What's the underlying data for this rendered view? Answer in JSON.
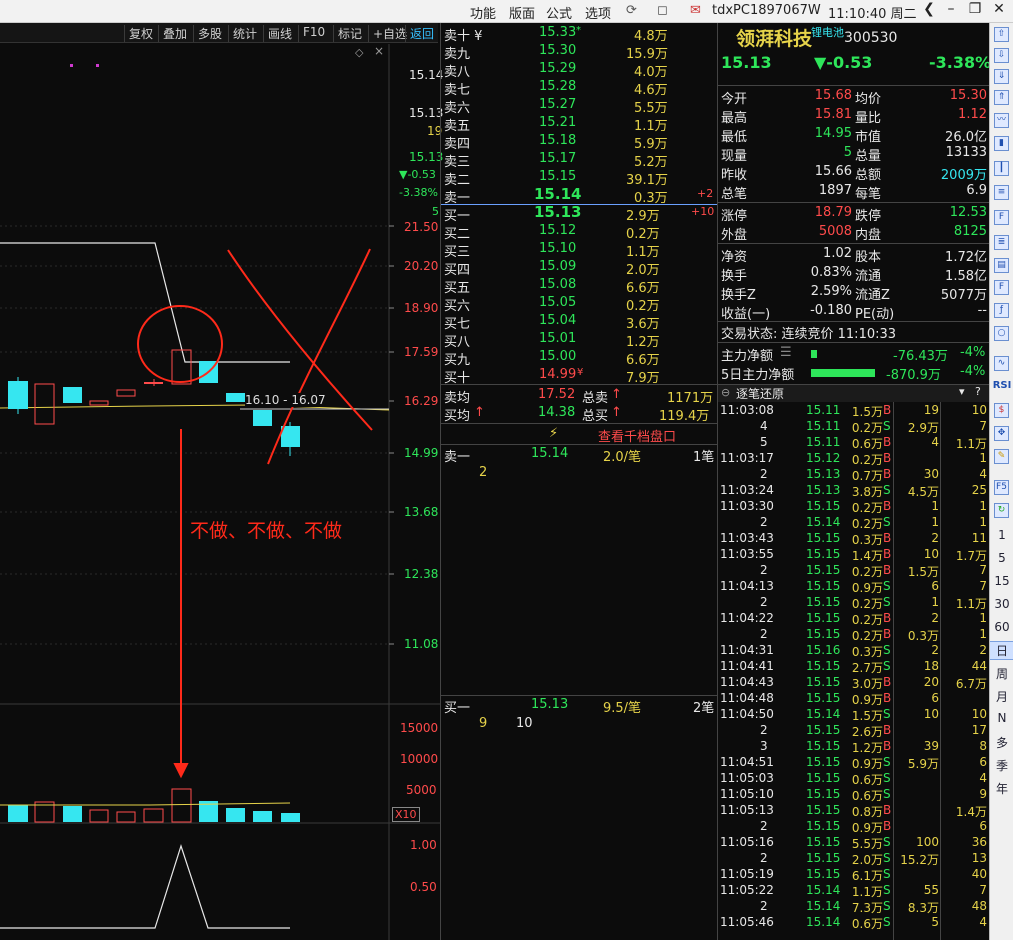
{
  "menubar": {
    "items": [
      "功能",
      "版面",
      "公式",
      "选项"
    ],
    "host": "tdxPC1897067W",
    "clock": "11:10:40 周二"
  },
  "toolbar": {
    "buttons": [
      "复权",
      "叠加",
      "多股",
      "统计",
      "画线",
      "F10",
      "标记",
      "+自选",
      "返回"
    ]
  },
  "chart": {
    "price_axis": [
      "21.50",
      "20.20",
      "18.90",
      "17.59",
      "16.29",
      "14.99",
      "13.68",
      "12.38",
      "11.08"
    ],
    "volume_axis": [
      "15000",
      "10000",
      "5000"
    ],
    "volume_unit": "X10",
    "indicator_axis": [
      "1.00",
      "0.50"
    ],
    "side_price": "15.14",
    "side_high": "15.13",
    "side_num": "19",
    "side_last": "15.13",
    "side_change": "▼-0.53",
    "side_pct": "-3.38%",
    "side_small": "5",
    "range_label": "16.10 - 16.07",
    "annotation": "不做、不做、不做"
  },
  "orderbook": {
    "asks": [
      {
        "label": "卖十 ¥",
        "price": "15.33",
        "mark": "*",
        "vol": "4.8万"
      },
      {
        "label": "卖九",
        "price": "15.30",
        "vol": "15.9万"
      },
      {
        "label": "卖八",
        "price": "15.29",
        "vol": "4.0万"
      },
      {
        "label": "卖七",
        "price": "15.28",
        "vol": "4.6万"
      },
      {
        "label": "卖六",
        "price": "15.27",
        "vol": "5.5万"
      },
      {
        "label": "卖五",
        "price": "15.21",
        "vol": "1.1万"
      },
      {
        "label": "卖四",
        "price": "15.18",
        "vol": "5.9万"
      },
      {
        "label": "卖三",
        "price": "15.17",
        "vol": "5.2万"
      },
      {
        "label": "卖二",
        "price": "15.15",
        "vol": "39.1万"
      },
      {
        "label": "卖一",
        "price": "15.14",
        "vol": "0.3万",
        "delta": "+2"
      }
    ],
    "bids": [
      {
        "label": "买一",
        "price": "15.13",
        "vol": "2.9万",
        "delta": "+10"
      },
      {
        "label": "买二",
        "price": "15.12",
        "vol": "0.2万"
      },
      {
        "label": "买三",
        "price": "15.10",
        "vol": "1.1万"
      },
      {
        "label": "买四",
        "price": "15.09",
        "vol": "2.0万"
      },
      {
        "label": "买五",
        "price": "15.08",
        "vol": "6.6万"
      },
      {
        "label": "买六",
        "price": "15.05",
        "vol": "0.2万"
      },
      {
        "label": "买七",
        "price": "15.04",
        "vol": "3.6万"
      },
      {
        "label": "买八",
        "price": "15.01",
        "vol": "1.2万"
      },
      {
        "label": "买九",
        "price": "15.00",
        "vol": "6.6万"
      },
      {
        "label": "买十",
        "price": "14.99",
        "mark": "¥",
        "vol": "7.9万"
      }
    ],
    "avg_sell": {
      "label": "卖均",
      "price": "17.52",
      "total_label": "总卖",
      "total": "1171万"
    },
    "avg_buy": {
      "label": "买均",
      "price": "14.38",
      "total_label": "总买",
      "total": "119.4万"
    },
    "thousand_link": "查看千档盘口",
    "queue_sell": {
      "label": "卖一",
      "price": "15.14",
      "per": "2.0/笔",
      "count": "1笔",
      "orders": [
        "2"
      ]
    },
    "queue_buy": {
      "label": "买一",
      "price": "15.13",
      "per": "9.5/笔",
      "count": "2笔",
      "orders": [
        "9",
        "10"
      ]
    }
  },
  "stock": {
    "name": "领湃科技",
    "tag": "锂电池",
    "code": "300530",
    "price": "15.13",
    "change": "▼-0.53",
    "pct": "-3.38%"
  },
  "stats": [
    [
      "今开",
      "15.68",
      "均价",
      "15.30"
    ],
    [
      "最高",
      "15.81",
      "量比",
      "1.12"
    ],
    [
      "最低",
      "14.95",
      "市值",
      "26.0亿"
    ],
    [
      "现量",
      "5",
      "总量",
      "13133"
    ],
    [
      "昨收",
      "15.66",
      "总额",
      "2009万"
    ],
    [
      "总笔",
      "1897",
      "每笔",
      "6.9"
    ],
    [
      "涨停",
      "18.79",
      "跌停",
      "12.53"
    ],
    [
      "外盘",
      "5008",
      "内盘",
      "8125"
    ],
    [
      "净资",
      "1.02",
      "股本",
      "1.72亿"
    ],
    [
      "换手",
      "0.83%",
      "流通",
      "1.58亿"
    ],
    [
      "换手Z",
      "2.59%",
      "流通Z",
      "5077万"
    ],
    [
      "收益(一)",
      "-0.180",
      "PE(动)",
      "--"
    ]
  ],
  "trade_status": "交易状态: 连续竞价 11:10:33",
  "capital": [
    {
      "label": "主力净额",
      "value": "-76.43万",
      "pct": "-4%"
    },
    {
      "label": "5日主力净额",
      "value": "-870.9万",
      "pct": "-4%"
    }
  ],
  "ticks_title": "逐笔还原",
  "ticks": [
    [
      "11:03:08",
      "15.11",
      "1.5万",
      "B",
      "19",
      "10"
    ],
    [
      "4",
      "15.11",
      "0.2万",
      "S",
      "2.9万",
      "7"
    ],
    [
      "5",
      "15.11",
      "0.6万",
      "B",
      "4",
      "1.1万"
    ],
    [
      "11:03:17",
      "15.12",
      "0.2万",
      "B",
      "",
      "1"
    ],
    [
      "2",
      "15.13",
      "0.7万",
      "B",
      "30",
      "4"
    ],
    [
      "11:03:24",
      "15.13",
      "3.8万",
      "S",
      "4.5万",
      "25"
    ],
    [
      "11:03:30",
      "15.15",
      "0.2万",
      "B",
      "1",
      "1"
    ],
    [
      "2",
      "15.14",
      "0.2万",
      "S",
      "1",
      "1"
    ],
    [
      "11:03:43",
      "15.15",
      "0.3万",
      "B",
      "2",
      "11"
    ],
    [
      "11:03:55",
      "15.15",
      "1.4万",
      "B",
      "10",
      "1.7万"
    ],
    [
      "2",
      "15.15",
      "0.2万",
      "B",
      "1.5万",
      "7"
    ],
    [
      "11:04:13",
      "15.15",
      "0.9万",
      "S",
      "6",
      "7"
    ],
    [
      "2",
      "15.15",
      "0.2万",
      "S",
      "1",
      "1.1万"
    ],
    [
      "11:04:22",
      "15.15",
      "0.2万",
      "B",
      "2",
      "1"
    ],
    [
      "2",
      "15.15",
      "0.2万",
      "B",
      "0.3万",
      "1"
    ],
    [
      "11:04:31",
      "15.16",
      "0.3万",
      "S",
      "2",
      "2"
    ],
    [
      "11:04:41",
      "15.15",
      "2.7万",
      "S",
      "18",
      "44"
    ],
    [
      "11:04:43",
      "15.15",
      "3.0万",
      "B",
      "20",
      "6.7万"
    ],
    [
      "11:04:48",
      "15.15",
      "0.9万",
      "B",
      "6",
      ""
    ],
    [
      "11:04:50",
      "15.14",
      "1.5万",
      "S",
      "10",
      "10"
    ],
    [
      "2",
      "15.15",
      "2.6万",
      "B",
      "",
      "17"
    ],
    [
      "3",
      "15.15",
      "1.2万",
      "B",
      "39",
      "8"
    ],
    [
      "11:04:51",
      "15.15",
      "0.9万",
      "S",
      "5.9万",
      "6"
    ],
    [
      "11:05:03",
      "15.15",
      "0.6万",
      "S",
      "",
      "4"
    ],
    [
      "11:05:10",
      "15.15",
      "0.6万",
      "S",
      "",
      "9"
    ],
    [
      "11:05:13",
      "15.15",
      "0.8万",
      "B",
      "",
      "1.4万"
    ],
    [
      "2",
      "15.15",
      "0.9万",
      "B",
      "",
      "6"
    ],
    [
      "11:05:16",
      "15.15",
      "5.5万",
      "S",
      "100",
      "36"
    ],
    [
      "2",
      "15.15",
      "2.0万",
      "S",
      "15.2万",
      "13"
    ],
    [
      "11:05:19",
      "15.15",
      "6.1万",
      "S",
      "",
      "40"
    ],
    [
      "11:05:22",
      "15.14",
      "1.1万",
      "S",
      "55",
      "7"
    ],
    [
      "2",
      "15.14",
      "7.3万",
      "S",
      "8.3万",
      "48"
    ],
    [
      "11:05:46",
      "15.14",
      "0.6万",
      "S",
      "5",
      "4"
    ]
  ],
  "sidebar": [
    "RSI",
    "1",
    "5",
    "15",
    "30",
    "60",
    "日",
    "周",
    "月",
    "N",
    "多",
    "季",
    "年"
  ],
  "colors": {
    "up": "#ff4b4b",
    "down": "#2ee65a",
    "cyan": "#36e6f0",
    "yellow": "#e6d34a",
    "annot": "#ff2a1a"
  }
}
